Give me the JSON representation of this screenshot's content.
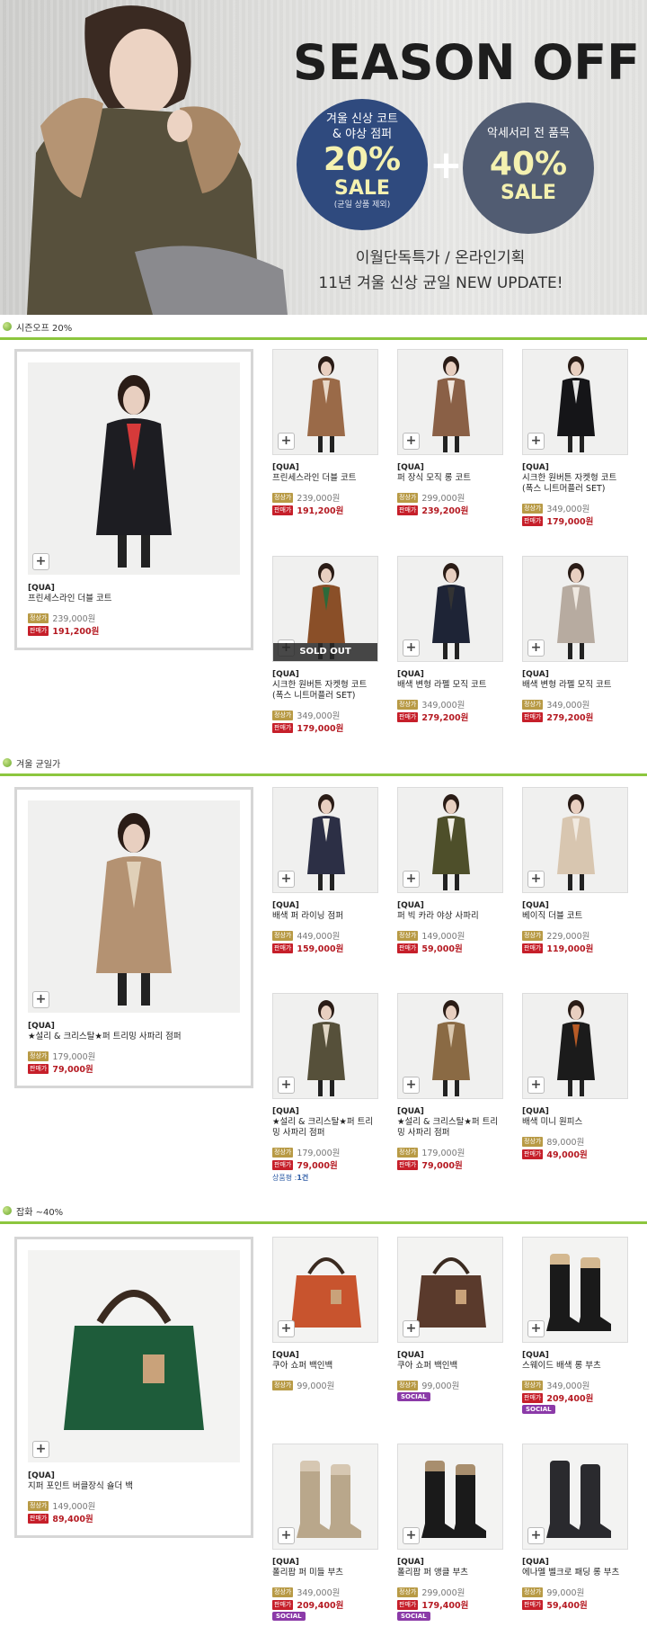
{
  "hero": {
    "title": "SEASON OFF",
    "circle1": {
      "line1": "겨울 신상 코트",
      "line2": "& 야상 점퍼",
      "percent": "20%",
      "sale": "SALE",
      "note": "(균일 상품 제외)"
    },
    "plus": "+",
    "circle2": {
      "line1": "악세서리 전 품목",
      "percent": "40%",
      "sale": "SALE"
    },
    "sub1": "이월단독특가 / 온라인기획",
    "sub2": "11년 겨울 신상 균일 NEW UPDATE!"
  },
  "labels": {
    "regular_tag": "정상가",
    "sale_tag": "판매가",
    "zoom": "+",
    "sold_out": "SOLD OUT",
    "social": "SOCIAL"
  },
  "sections": [
    {
      "title": "시즌오프 20%",
      "feature": {
        "brand": "[QUA]",
        "name": "프린세스라인 더블 코트",
        "regular": "239,000원",
        "sale": "191,200원"
      },
      "items": [
        {
          "brand": "[QUA]",
          "name": "프린세스라인 더블 코트",
          "regular": "239,000원",
          "sale": "191,200원"
        },
        {
          "brand": "[QUA]",
          "name": "퍼 장식 모직 롱 코트",
          "regular": "299,000원",
          "sale": "239,200원"
        },
        {
          "brand": "[QUA]",
          "name": "시크한 원버튼 자켓형 코트 (폭스 니트머플러 SET)",
          "regular": "349,000원",
          "sale": "179,000원"
        },
        {
          "brand": "[QUA]",
          "name": "시크한 원버튼 자켓형 코트 (폭스 니트머플러 SET)",
          "regular": "349,000원",
          "sale": "179,000원"
        },
        {
          "brand": "[QUA]",
          "name": "배색 변형 라펠 모직 코트",
          "regular": "349,000원",
          "sale": "279,200원"
        },
        {
          "brand": "[QUA]",
          "name": "배색 변형 라펠 모직 코트",
          "regular": "349,000원",
          "sale": "279,200원"
        }
      ]
    },
    {
      "title": "겨울 균일가",
      "feature": {
        "brand": "[QUA]",
        "name": "★설리 & 크리스탈★퍼 트리밍 사파리 점퍼",
        "regular": "179,000원",
        "sale": "79,000원"
      },
      "items": [
        {
          "brand": "[QUA]",
          "name": "배색 퍼 라이닝 점퍼",
          "regular": "449,000원",
          "sale": "159,000원"
        },
        {
          "brand": "[QUA]",
          "name": "퍼 빅 카라 야상 사파리",
          "regular": "149,000원",
          "sale": "59,000원"
        },
        {
          "brand": "[QUA]",
          "name": "베이직 더블 코트",
          "regular": "229,000원",
          "sale": "119,000원"
        },
        {
          "brand": "[QUA]",
          "name": "★설리 & 크리스탈★퍼 트리밍 사파리 점퍼",
          "regular": "179,000원",
          "sale": "79,000원",
          "stock_label": "상품평 :",
          "stock_value": "1건"
        },
        {
          "brand": "[QUA]",
          "name": "★설리 & 크리스탈★퍼 트리밍 사파리 점퍼",
          "regular": "179,000원",
          "sale": "79,000원"
        },
        {
          "brand": "[QUA]",
          "name": "배색 미니 원피스",
          "regular": "89,000원",
          "sale": "49,000원"
        }
      ]
    },
    {
      "title": "잡화 ~40%",
      "feature": {
        "brand": "[QUA]",
        "name": "지퍼 포인트 버클장식 숄더 백",
        "regular": "149,000원",
        "sale": "89,400원"
      },
      "items": [
        {
          "brand": "[QUA]",
          "name": "쿠아 쇼퍼 백인백",
          "regular": "99,000원"
        },
        {
          "brand": "[QUA]",
          "name": "쿠아 쇼퍼 백인백",
          "regular": "99,000원"
        },
        {
          "brand": "[QUA]",
          "name": "스웨이드 배색 롱 부츠",
          "regular": "349,000원",
          "sale": "209,400원"
        },
        {
          "brand": "[QUA]",
          "name": "폴리팝 퍼 미들 부츠",
          "regular": "349,000원",
          "sale": "209,400원"
        },
        {
          "brand": "[QUA]",
          "name": "폴리팝 퍼 앵클 부츠",
          "regular": "299,000원",
          "sale": "179,400원"
        },
        {
          "brand": "[QUA]",
          "name": "에나멜 벨크로 패딩 롱 부츠",
          "regular": "99,000원",
          "sale": "59,400원"
        }
      ]
    }
  ]
}
